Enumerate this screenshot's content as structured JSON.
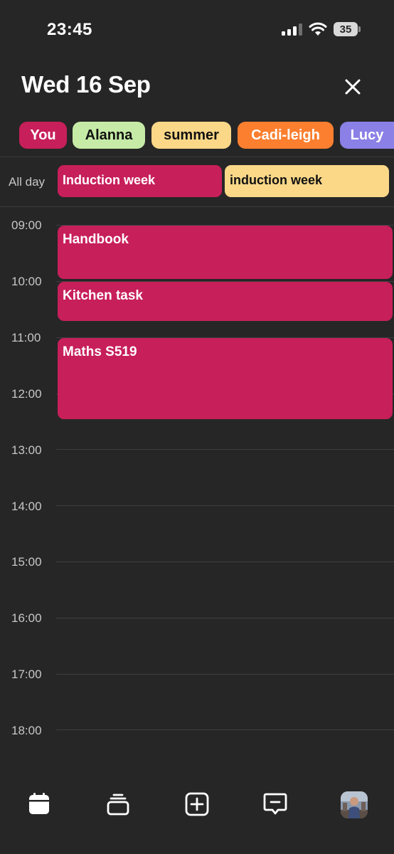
{
  "status_bar": {
    "time": "23:45",
    "battery": "35"
  },
  "header": {
    "date_title": "Wed 16 Sep"
  },
  "people": [
    {
      "name": "You",
      "bg": "#c71f59",
      "fg": "#ffffff"
    },
    {
      "name": "Alanna",
      "bg": "#c6eba6",
      "fg": "#111111"
    },
    {
      "name": "summer",
      "bg": "#fad888",
      "fg": "#111111"
    },
    {
      "name": "Cadi-leigh",
      "bg": "#fb7f2f",
      "fg": "#ffffff"
    },
    {
      "name": "Lucy",
      "bg": "#8b80e6",
      "fg": "#ffffff"
    }
  ],
  "all_day": {
    "label": "All day",
    "events": [
      {
        "title": "Induction week",
        "bg": "#c71f59",
        "fg": "#ffffff"
      },
      {
        "title": "induction week",
        "bg": "#fad888",
        "fg": "#111111"
      }
    ]
  },
  "hours": [
    "09:00",
    "10:00",
    "11:00",
    "12:00",
    "13:00",
    "14:00",
    "15:00",
    "16:00",
    "17:00",
    "18:00"
  ],
  "events": [
    {
      "title": "Handbook"
    },
    {
      "title": "Kitchen task"
    },
    {
      "title": "Maths S519"
    }
  ],
  "nav": {
    "icons": [
      "calendar-icon",
      "stack-icon",
      "add-icon",
      "message-icon",
      "avatar"
    ]
  },
  "colors": {
    "background": "#262626",
    "event": "#c71f59"
  }
}
